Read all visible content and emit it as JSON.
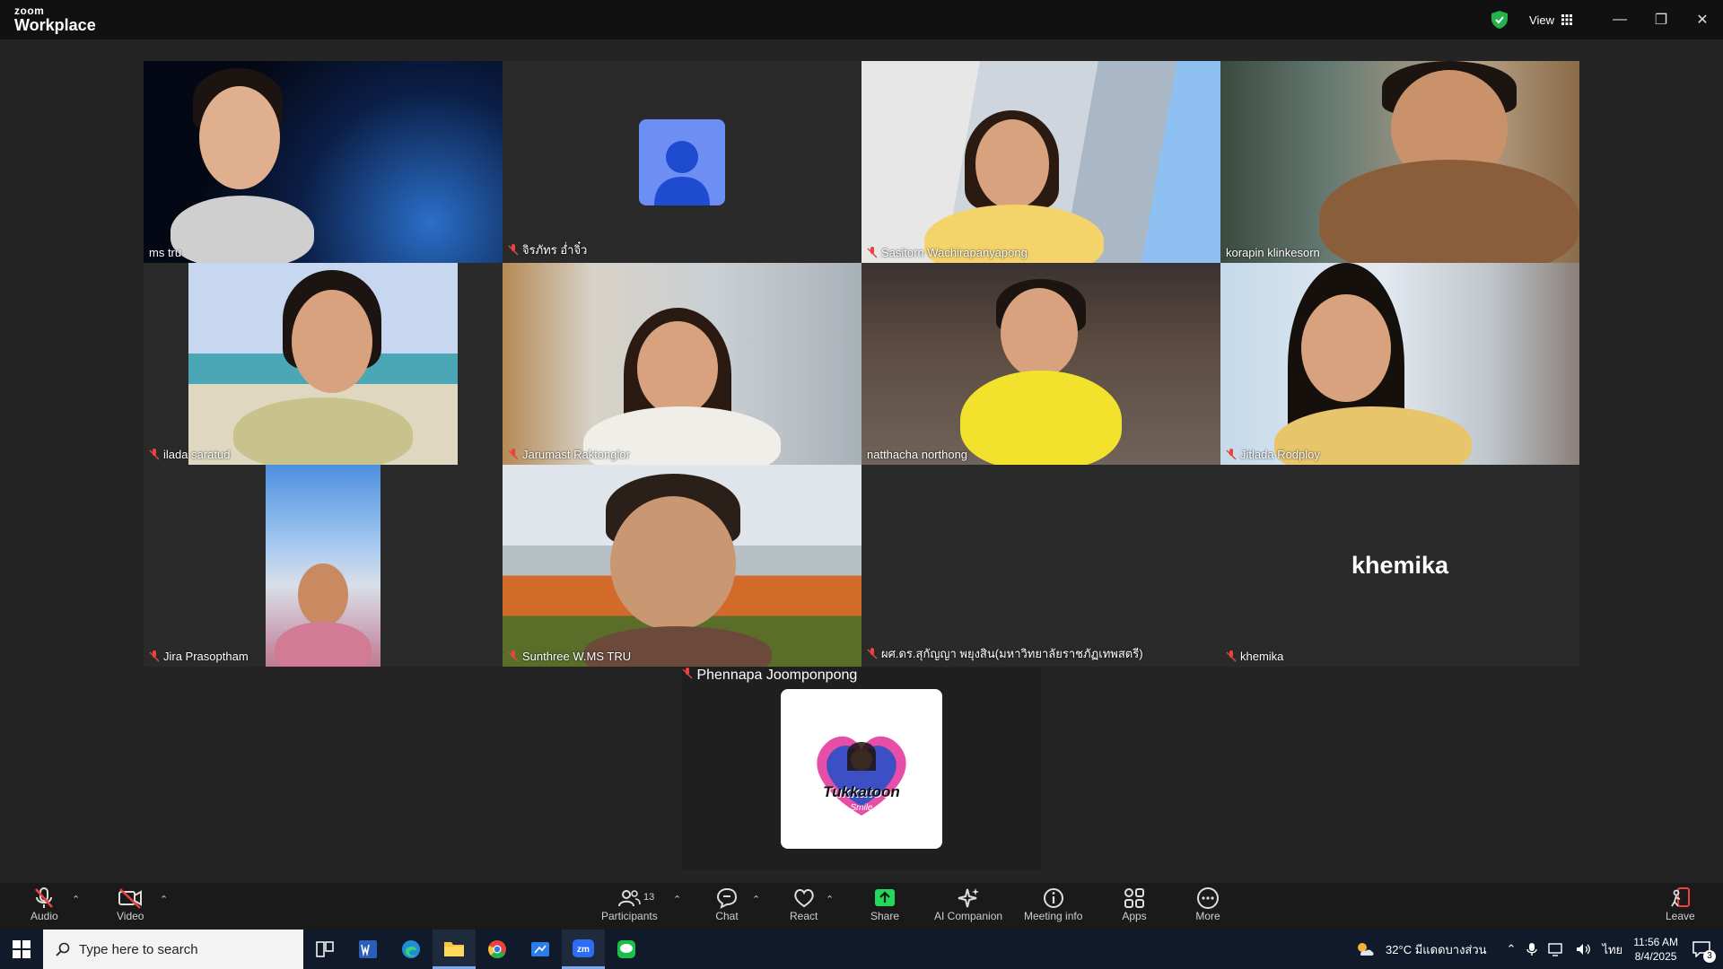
{
  "app": {
    "brand_top": "zoom",
    "brand_bottom": "Workplace"
  },
  "titlebar": {
    "view_label": "View",
    "controls": [
      "minimize-icon",
      "restore-icon",
      "close-icon"
    ]
  },
  "participants": [
    {
      "name": "ms tru",
      "muted": false,
      "active": true
    },
    {
      "name": "จิรภัทร อ่ำจิ๋ว",
      "muted": true,
      "avatar": true
    },
    {
      "name": "Sasitorn Wachirapanyapong",
      "muted": true
    },
    {
      "name": "korapin klinkesorn",
      "muted": false
    },
    {
      "name": "ilada saratud",
      "muted": true
    },
    {
      "name": "Jarumast Raktonglor",
      "muted": true
    },
    {
      "name": "natthacha northong",
      "muted": false
    },
    {
      "name": "Jitlada Rodploy",
      "muted": true
    },
    {
      "name": "Jira Prasoptham",
      "muted": true
    },
    {
      "name": "Sunthree W.MS TRU",
      "muted": true
    },
    {
      "name": "ผศ.ดร.สุกัญญา พยุงสิน(มหาวิทยาลัยราชภัฏเทพสตรี)",
      "muted": true,
      "no_video": true
    },
    {
      "name": "khemika",
      "muted": true,
      "no_video": true,
      "big_label": "khemika"
    }
  ],
  "pinned": {
    "name": "Phennapa Joomponpong",
    "muted": true,
    "logo_text": "Tukkatoon",
    "logo_sub": "Smile"
  },
  "toolbar": {
    "audio": "Audio",
    "video": "Video",
    "participants": "Participants",
    "participants_count": "13",
    "chat": "Chat",
    "react": "React",
    "share": "Share",
    "ai": "AI Companion",
    "info": "Meeting info",
    "apps": "Apps",
    "more": "More",
    "leave": "Leave"
  },
  "taskbar": {
    "search_placeholder": "Type here to search",
    "weather": "32°C มีแดดบางส่วน",
    "lang": "ไทย",
    "time": "11:56 AM",
    "date": "8/4/2025",
    "notifications": "3"
  },
  "colors": {
    "active_border": "#23d959",
    "share_green": "#23d959",
    "mute_red": "#e8433e"
  }
}
